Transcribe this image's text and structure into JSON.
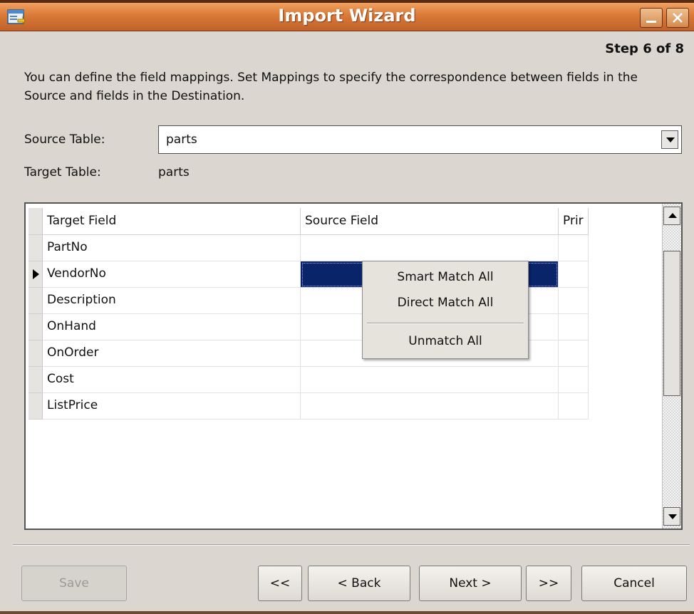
{
  "window": {
    "title": "Import Wizard",
    "minimize_label": "_",
    "close_label": "×"
  },
  "step": "Step 6 of 8",
  "description": "You can define the field mappings. Set Mappings to specify the correspondence between fields in the Source and fields in the Destination.",
  "source_table": {
    "label": "Source Table:",
    "value": "parts"
  },
  "target_table": {
    "label": "Target Table:",
    "value": "parts"
  },
  "grid": {
    "columns": [
      "Target Field",
      "Source Field",
      "Prir"
    ],
    "rows": [
      {
        "target": "PartNo",
        "source": "",
        "primary": ""
      },
      {
        "target": "VendorNo",
        "source": "",
        "primary": ""
      },
      {
        "target": "Description",
        "source": "",
        "primary": ""
      },
      {
        "target": "OnHand",
        "source": "",
        "primary": ""
      },
      {
        "target": "OnOrder",
        "source": "",
        "primary": ""
      },
      {
        "target": "Cost",
        "source": "",
        "primary": ""
      },
      {
        "target": "ListPrice",
        "source": "",
        "primary": ""
      }
    ],
    "current_row": "VendorNo"
  },
  "context_menu": {
    "items": [
      "Smart Match All",
      "Direct Match All",
      "Unmatch All"
    ]
  },
  "buttons": {
    "save": "Save",
    "first": "<<",
    "back": "< Back",
    "next": "Next >",
    "last": ">>",
    "cancel": "Cancel"
  },
  "colors": {
    "titlebar": "#d97a37",
    "window_bg": "#dbd7d0",
    "selection": "#0a246a"
  }
}
